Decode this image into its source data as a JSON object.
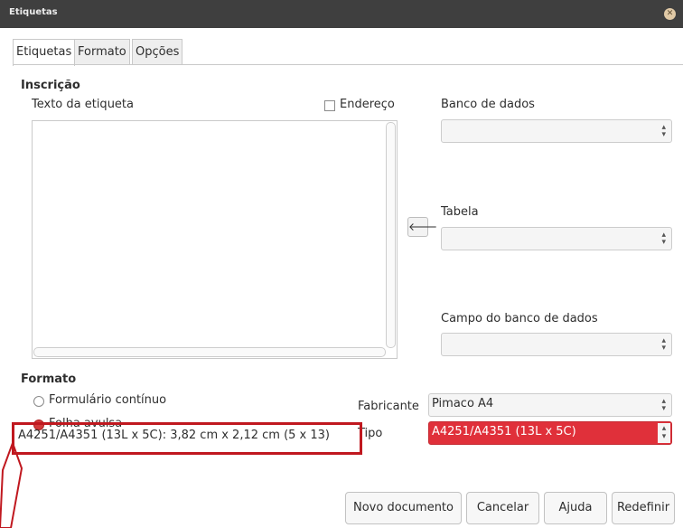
{
  "window": {
    "title": "Etiquetas"
  },
  "tabs": [
    {
      "label": "Etiquetas",
      "active": true
    },
    {
      "label": "Formato",
      "active": false
    },
    {
      "label": "Opções",
      "active": false
    }
  ],
  "inscricao": {
    "section_label": "Inscrição",
    "text_label": "Texto da etiqueta",
    "address_checkbox": "Endereço",
    "address_checked": false,
    "database_label": "Banco de dados",
    "database_value": "",
    "table_label": "Tabela",
    "table_value": "",
    "field_label": "Campo do banco de dados",
    "field_value": ""
  },
  "formato": {
    "section_label": "Formato",
    "continuous_label": "Formulário contínuo",
    "sheet_label": "Folha avulsa",
    "selected": "Folha avulsa",
    "brand_label": "Fabricante",
    "brand_value": "Pimaco A4",
    "type_label": "Tipo",
    "type_value": "A4251/A4351 (13L x 5C)"
  },
  "status": {
    "text": "A4251/A4351 (13L x 5C): 3,82 cm x 2,12 cm (5 x 13)"
  },
  "buttons": {
    "new_document": "Novo documento",
    "cancel": "Cancelar",
    "help": "Ajuda",
    "reset": "Redefinir"
  },
  "colors": {
    "highlight": "#c0181f",
    "selected_combo": "#e0303a",
    "titlebar": "#3f3f3f"
  }
}
